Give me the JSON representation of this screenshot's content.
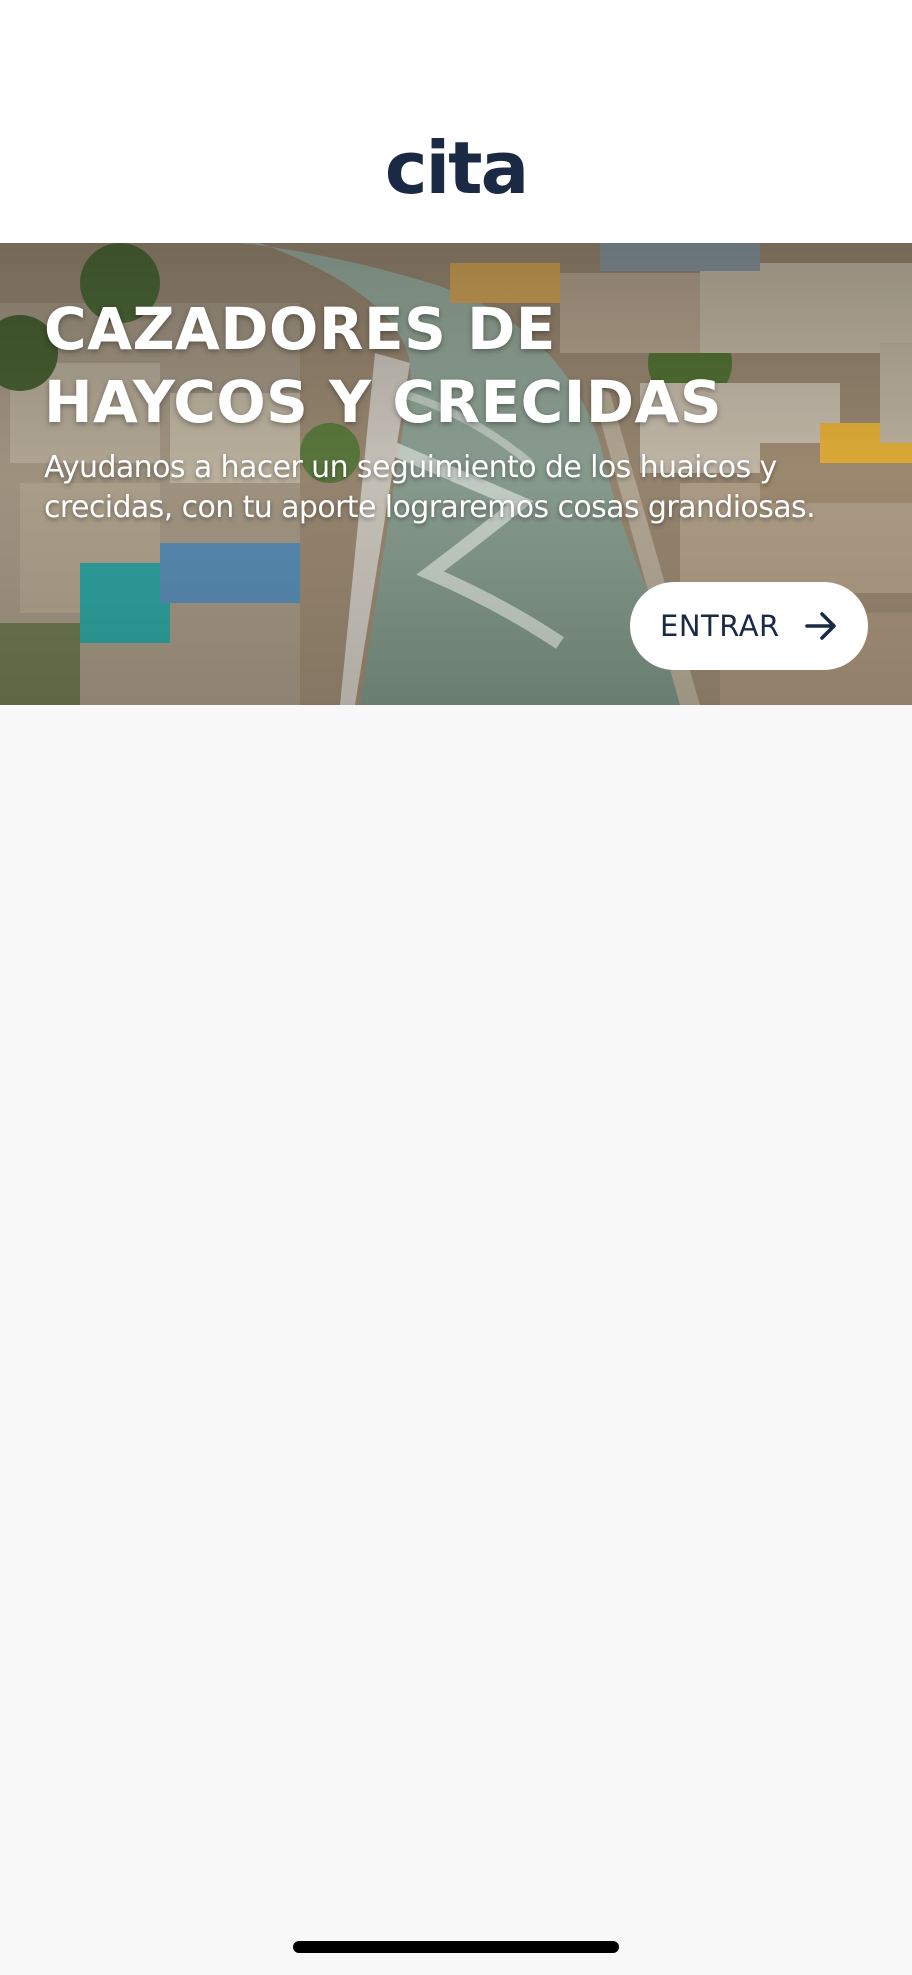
{
  "header": {
    "logo_text": "cita"
  },
  "hero": {
    "title_line1": "CAZADORES DE",
    "title_line2": "HAYCOS Y CRECIDAS",
    "subtitle_line1": "Ayudanos a hacer un seguimiento de los huaicos y",
    "subtitle_line2": "crecidas, con tu aporte lograremos cosas grandiosas.",
    "background_icon": "river-aerial-photo"
  },
  "enter_button": {
    "label": "ENTRAR",
    "icon": "arrow-right-icon"
  },
  "colors": {
    "brand_navy": "#1b2a44",
    "page_background": "#f8f8f8",
    "header_background": "#ffffff"
  }
}
